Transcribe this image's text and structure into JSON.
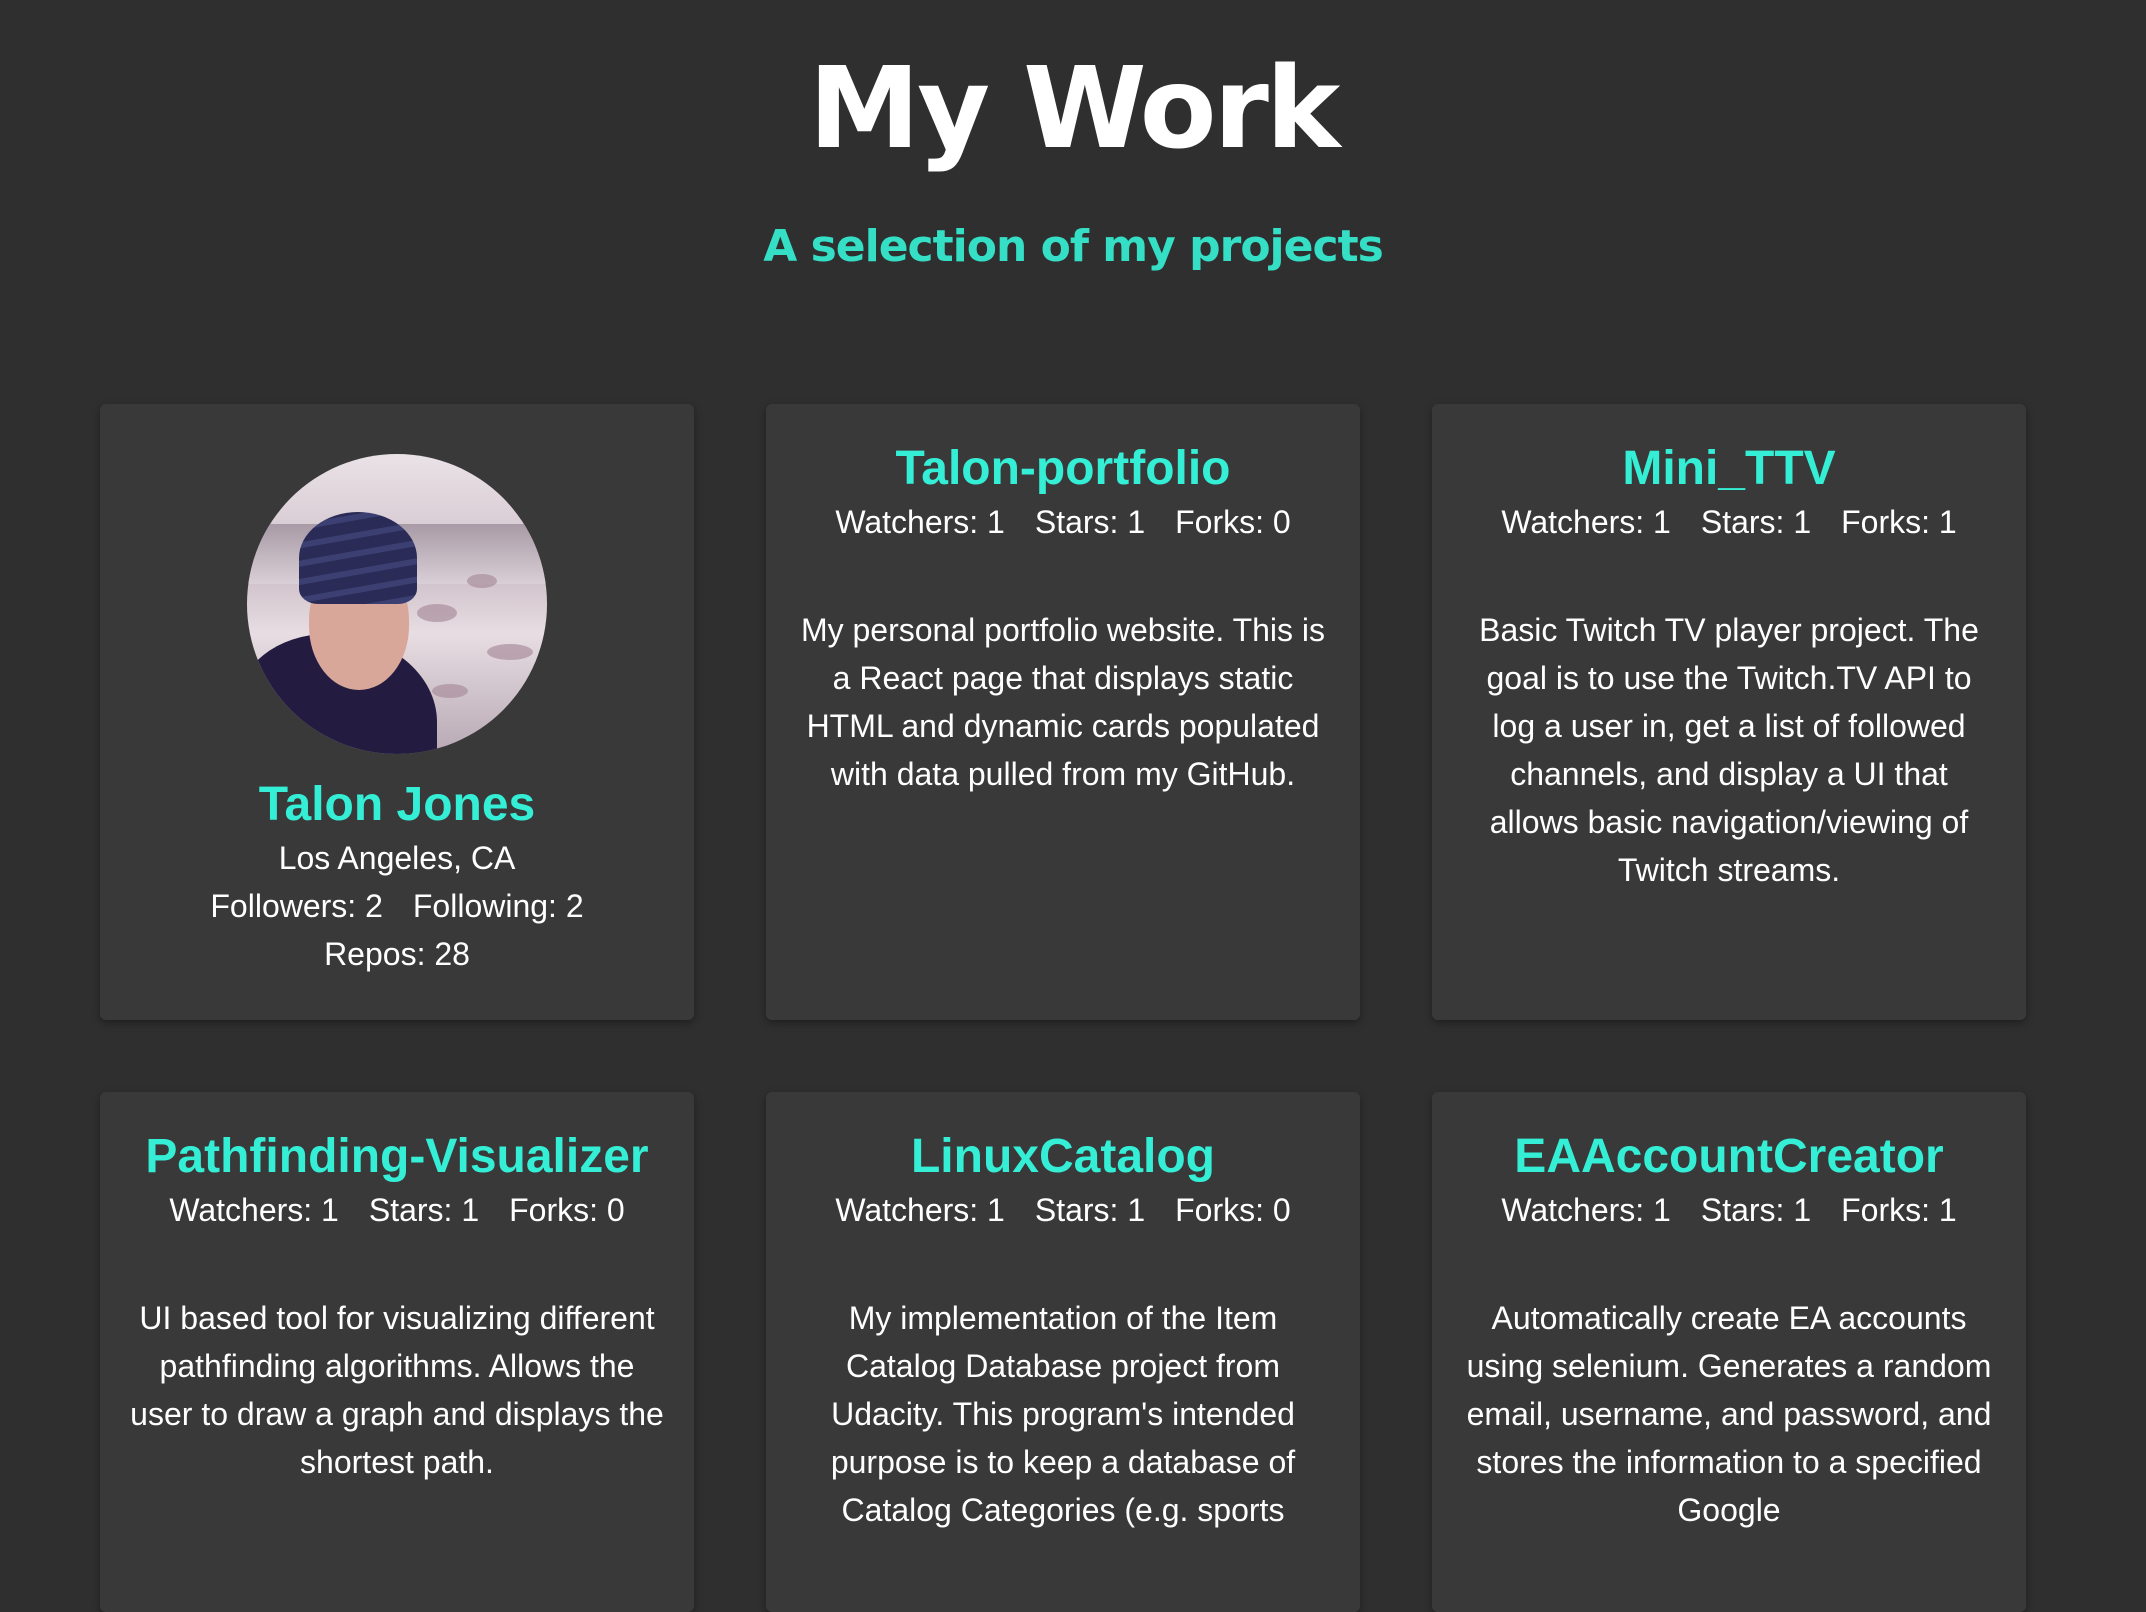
{
  "header": {
    "title": "My Work",
    "subtitle": "A selection of my projects"
  },
  "profile": {
    "name": "Talon Jones",
    "location": "Los Angeles, CA",
    "followers": "Followers: 2",
    "following": "Following: 2",
    "repos": "Repos: 28"
  },
  "repos": [
    {
      "title": "Talon-portfolio",
      "watchers": "Watchers: 1",
      "stars": "Stars: 1",
      "forks": "Forks: 0",
      "description": "My personal portfolio website. This is a React page that displays static HTML and dynamic cards populated with data pulled from my GitHub."
    },
    {
      "title": "Mini_TTV",
      "watchers": "Watchers: 1",
      "stars": "Stars: 1",
      "forks": "Forks: 1",
      "description": "Basic Twitch TV player project. The goal is to use the Twitch.TV API to log a user in, get a list of followed channels, and display a UI that allows basic navigation/viewing of Twitch streams."
    },
    {
      "title": "Pathfinding-Visualizer",
      "watchers": "Watchers: 1",
      "stars": "Stars: 1",
      "forks": "Forks: 0",
      "description": "UI based tool for visualizing different pathfinding algorithms. Allows the user to draw a graph and displays the shortest path."
    },
    {
      "title": "LinuxCatalog",
      "watchers": "Watchers: 1",
      "stars": "Stars: 1",
      "forks": "Forks: 0",
      "description": "My implementation of the Item Catalog Database project from Udacity. This program's intended purpose is to keep a database of Catalog Categories (e.g. sports"
    },
    {
      "title": "EAAccountCreator",
      "watchers": "Watchers: 1",
      "stars": "Stars: 1",
      "forks": "Forks: 1",
      "description": "Automatically create EA accounts using selenium. Generates a random email, username, and password, and stores the information to a specified Google"
    }
  ],
  "colors": {
    "background": "#2f2f2f",
    "card": "#393939",
    "accent": "#34efd6",
    "subtitle": "#34dfc6"
  }
}
